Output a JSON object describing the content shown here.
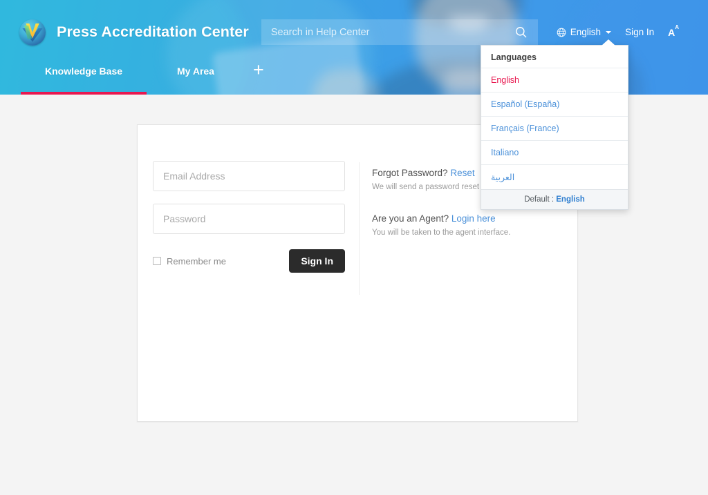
{
  "header": {
    "site_title": "Press Accreditation Center",
    "logo_icon": "logo-chevron-emblem",
    "search": {
      "placeholder": "Search in Help Center",
      "value": "",
      "icon": "search-icon"
    },
    "right": {
      "globe_icon": "globe-icon",
      "language_label": "English",
      "caret_icon": "chevron-down-icon",
      "sign_in_label": "Sign In",
      "text_size_icon": "text-resize-icon",
      "text_size_label": "A"
    },
    "nav": {
      "items": [
        {
          "label": "Knowledge Base",
          "active": true
        },
        {
          "label": "My Area",
          "active": false
        }
      ],
      "add_icon": "plus-icon",
      "active_underline_color": "#e8184f"
    },
    "colors": {
      "gradient_left": "#2cb4dc",
      "gradient_right": "#3b94e8"
    }
  },
  "language_dropdown": {
    "title": "Languages",
    "items": [
      {
        "label": "English",
        "selected": true
      },
      {
        "label": "Español (España)",
        "selected": false
      },
      {
        "label": "Français (France)",
        "selected": false
      },
      {
        "label": "Italiano",
        "selected": false
      },
      {
        "label": "العربية",
        "selected": false
      }
    ],
    "footer_prefix": "Default : ",
    "footer_value": "English",
    "selected_color": "#e8184f",
    "link_color": "#4a90d9"
  },
  "login": {
    "email": {
      "placeholder": "Email Address",
      "value": ""
    },
    "password": {
      "placeholder": "Password",
      "value": ""
    },
    "remember_label": "Remember me",
    "remember_checked": false,
    "sign_in_label": "Sign In",
    "forgot": {
      "question": "Forgot Password?",
      "link": "Reset",
      "note": "We will send a password reset link to your email."
    },
    "agent": {
      "question": "Are you an Agent?",
      "link": "Login here",
      "note": "You will be taken to the agent interface."
    }
  }
}
